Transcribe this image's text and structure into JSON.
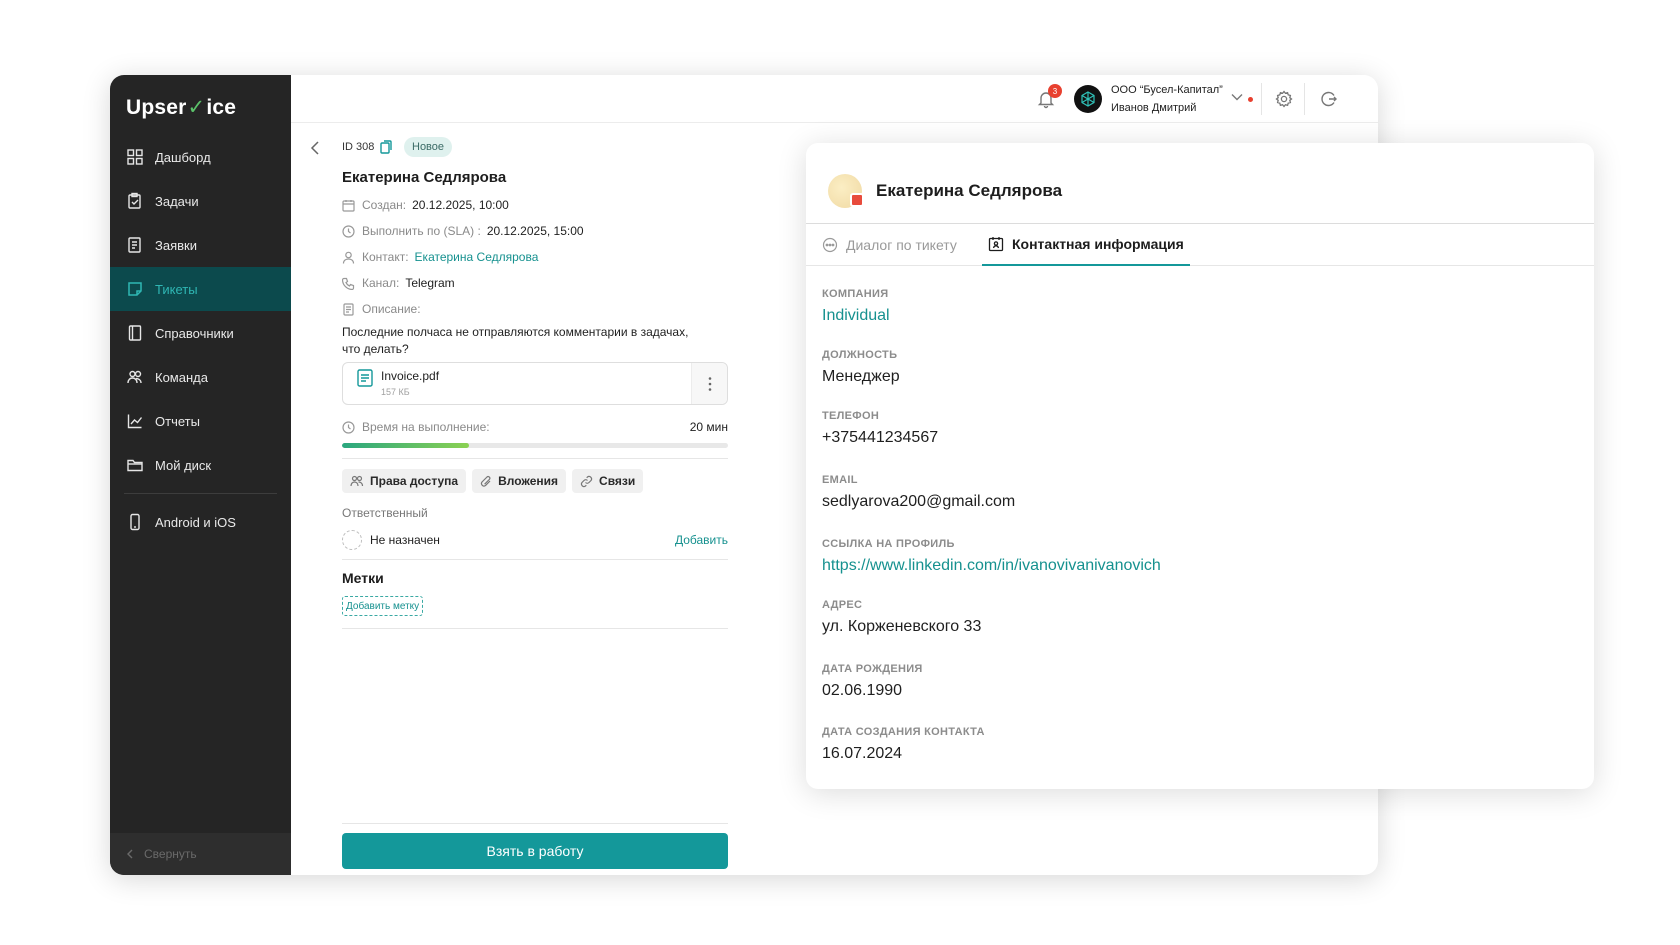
{
  "app": {
    "logo_before": "Upser",
    "logo_v": "V",
    "logo_after": "ice"
  },
  "sidebar": {
    "items": [
      {
        "label": "Дашборд",
        "icon": "dashboard-icon"
      },
      {
        "label": "Задачи",
        "icon": "tasks-icon"
      },
      {
        "label": "Заявки",
        "icon": "requests-icon"
      },
      {
        "label": "Тикеты",
        "icon": "tickets-icon",
        "active": true
      },
      {
        "label": "Справочники",
        "icon": "book-icon"
      },
      {
        "label": "Команда",
        "icon": "team-icon"
      },
      {
        "label": "Отчеты",
        "icon": "chart-icon"
      },
      {
        "label": "Мой диск",
        "icon": "folder-icon"
      }
    ],
    "mobile": {
      "label": "Android и iOS",
      "icon": "phone-icon"
    },
    "collapse_label": "Свернуть"
  },
  "header": {
    "notifications_count": "3",
    "company": "ООО “Бусел-Капитал”",
    "user": "Иванов Дмитрий",
    "accent": "#14989a"
  },
  "ticket": {
    "id": "ID 308",
    "status": "Новое",
    "title": "Екатерина Седлярова",
    "created_label": "Создан:",
    "created_value": "20.12.2025, 10:00",
    "sla_label": "Выполнить по (SLA) :",
    "sla_value": "20.12.2025, 15:00",
    "contact_label": "Контакт:",
    "contact_value": "Екатерина Седлярова",
    "channel_label": "Канал:",
    "channel_value": "Telegram",
    "description_label": "Описание:",
    "description": "Последние полчаса не отправляются комментарии в задачах, что делать?",
    "file": {
      "name": "Invoice.pdf",
      "size": "157 КБ"
    },
    "time_label": "Время на выполнение:",
    "time_value": "20 мин",
    "progress_fraction": 0.33,
    "chips": [
      "Права доступа",
      "Вложения",
      "Связи"
    ],
    "responsible_label": "Ответственный",
    "assignee": "Не назначен",
    "add_label": "Добавить",
    "tags_title": "Метки",
    "add_tag": "Добавить метку",
    "take_button": "Взять в работу"
  },
  "contact_card": {
    "name": "Екатерина Седлярова",
    "tabs": [
      "Диалог по тикету",
      "Контактная информация"
    ],
    "active_tab": 1,
    "fields": [
      {
        "label": "КОМПАНИЯ",
        "value": "Individual",
        "link": true
      },
      {
        "label": "ДОЛЖНОСТЬ",
        "value": "Менеджер"
      },
      {
        "label": "ТЕЛЕФОН",
        "value": "+375441234567"
      },
      {
        "label": "EMAIL",
        "value": "sedlyarova200@gmail.com"
      },
      {
        "label": "ССЫЛКА НА ПРОФИЛЬ",
        "value": "https://www.linkedin.com/in/ivanovivanivanovich",
        "link": true
      },
      {
        "label": "АДРЕС",
        "value": "ул. Корженевского 33"
      },
      {
        "label": "ДАТА РОЖДЕНИЯ",
        "value": "02.06.1990"
      },
      {
        "label": "ДАТА СОЗДАНИЯ КОНТАКТА",
        "value": "16.07.2024"
      }
    ]
  }
}
